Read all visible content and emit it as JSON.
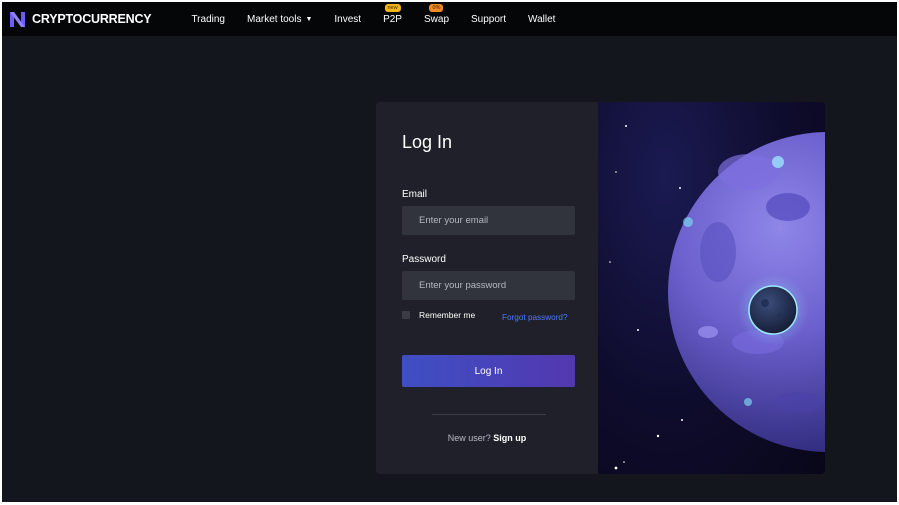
{
  "brand": {
    "name": "CRYPTOCURRENCY",
    "accent": "#6d5dfc"
  },
  "nav": {
    "items": [
      {
        "label": "Trading"
      },
      {
        "label": "Market tools",
        "dropdown_icon": "caret-down-icon"
      },
      {
        "label": "Invest"
      },
      {
        "label": "P2P",
        "badge": "new"
      },
      {
        "label": "Swap",
        "badge": "0%"
      },
      {
        "label": "Support"
      },
      {
        "label": "Wallet"
      }
    ]
  },
  "login": {
    "title": "Log In",
    "email_label": "Email",
    "email_placeholder": "Enter your email",
    "password_label": "Password",
    "password_placeholder": "Enter your password",
    "remember_label": "Remember me",
    "forgot_label": "Forgot password?",
    "submit_label": "Log In",
    "new_user_text": "New user?",
    "signup_label": "Sign up"
  },
  "colors": {
    "page_bg": "#14161d",
    "topbar_bg": "#050608",
    "card_bg": "#1f2029",
    "input_bg": "#32343d",
    "link": "#4b7bff",
    "button_start": "#3f4fc4",
    "button_end": "#5238b0"
  }
}
